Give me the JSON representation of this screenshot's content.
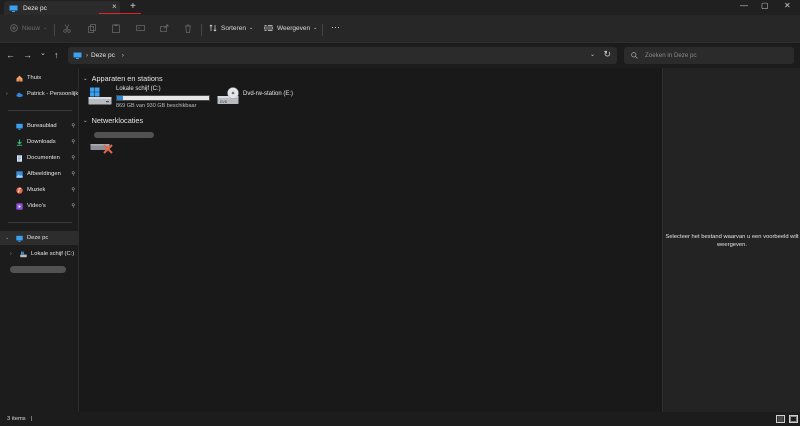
{
  "window": {
    "tab_title": "Deze pc",
    "tab_close": "×",
    "new_tab": "+",
    "minimize": "—",
    "maximize": "▢",
    "close": "✕",
    "accent_underline_color": "#e0262b"
  },
  "toolbar": {
    "new_label": "Nieuw",
    "sort_label": "Sorteren",
    "view_label": "Weergeven",
    "more_label": "···",
    "icons": [
      "plus-icon",
      "cut-icon",
      "copy-icon",
      "paste-icon",
      "rename-icon",
      "share-icon",
      "delete-icon",
      "sort-icon",
      "view-icon"
    ]
  },
  "navigation": {
    "back": "←",
    "forward": "→",
    "recent": "⌄",
    "up": "↑"
  },
  "address": {
    "crumb": "Deze pc",
    "separator": "›",
    "dropdown": "⌄",
    "refresh": "↻"
  },
  "search": {
    "placeholder": "Zoeken in Deze pc"
  },
  "sidebar": {
    "items": [
      {
        "label": "Thuis",
        "icon": "home-icon"
      },
      {
        "label": "Patrick - Persoonlijk",
        "icon": "cloud-icon"
      },
      {
        "label": "Bureaublad",
        "icon": "desktop-icon",
        "pinned": true
      },
      {
        "label": "Downloads",
        "icon": "download-icon",
        "pinned": true
      },
      {
        "label": "Documenten",
        "icon": "document-icon",
        "pinned": true
      },
      {
        "label": "Afbeeldingen",
        "icon": "pictures-icon",
        "pinned": true
      },
      {
        "label": "Muziek",
        "icon": "music-icon",
        "pinned": true
      },
      {
        "label": "Video's",
        "icon": "videos-icon",
        "pinned": true
      },
      {
        "label": "Deze pc",
        "icon": "computer-icon",
        "selected": true
      },
      {
        "label": "Lokale schijf (C:)",
        "icon": "drive-icon"
      }
    ],
    "pin_glyph": "⚲",
    "expand_glyph": "›",
    "expanded_glyph": "⌄"
  },
  "content": {
    "groups": [
      {
        "title": "Apparaten en stations",
        "chevron": "⌄"
      },
      {
        "title": "Netwerklocaties",
        "chevron": "⌄"
      }
    ],
    "drives": [
      {
        "name": "Lokale schijf (C:)",
        "usage_text": "869 GB van 930 GB beschikbaar",
        "used_fraction": 0.066,
        "icon": "windows-drive-icon",
        "bar_color": "#2f86d6"
      },
      {
        "name": "Dvd-rw-station (E:)",
        "icon": "dvd-drive-icon",
        "icon_label": "DVD"
      }
    ]
  },
  "preview": {
    "message": "Selecteer het bestand waarvan u een voorbeeld wilt weergeven."
  },
  "status": {
    "count": "3 items",
    "divider": "|"
  }
}
